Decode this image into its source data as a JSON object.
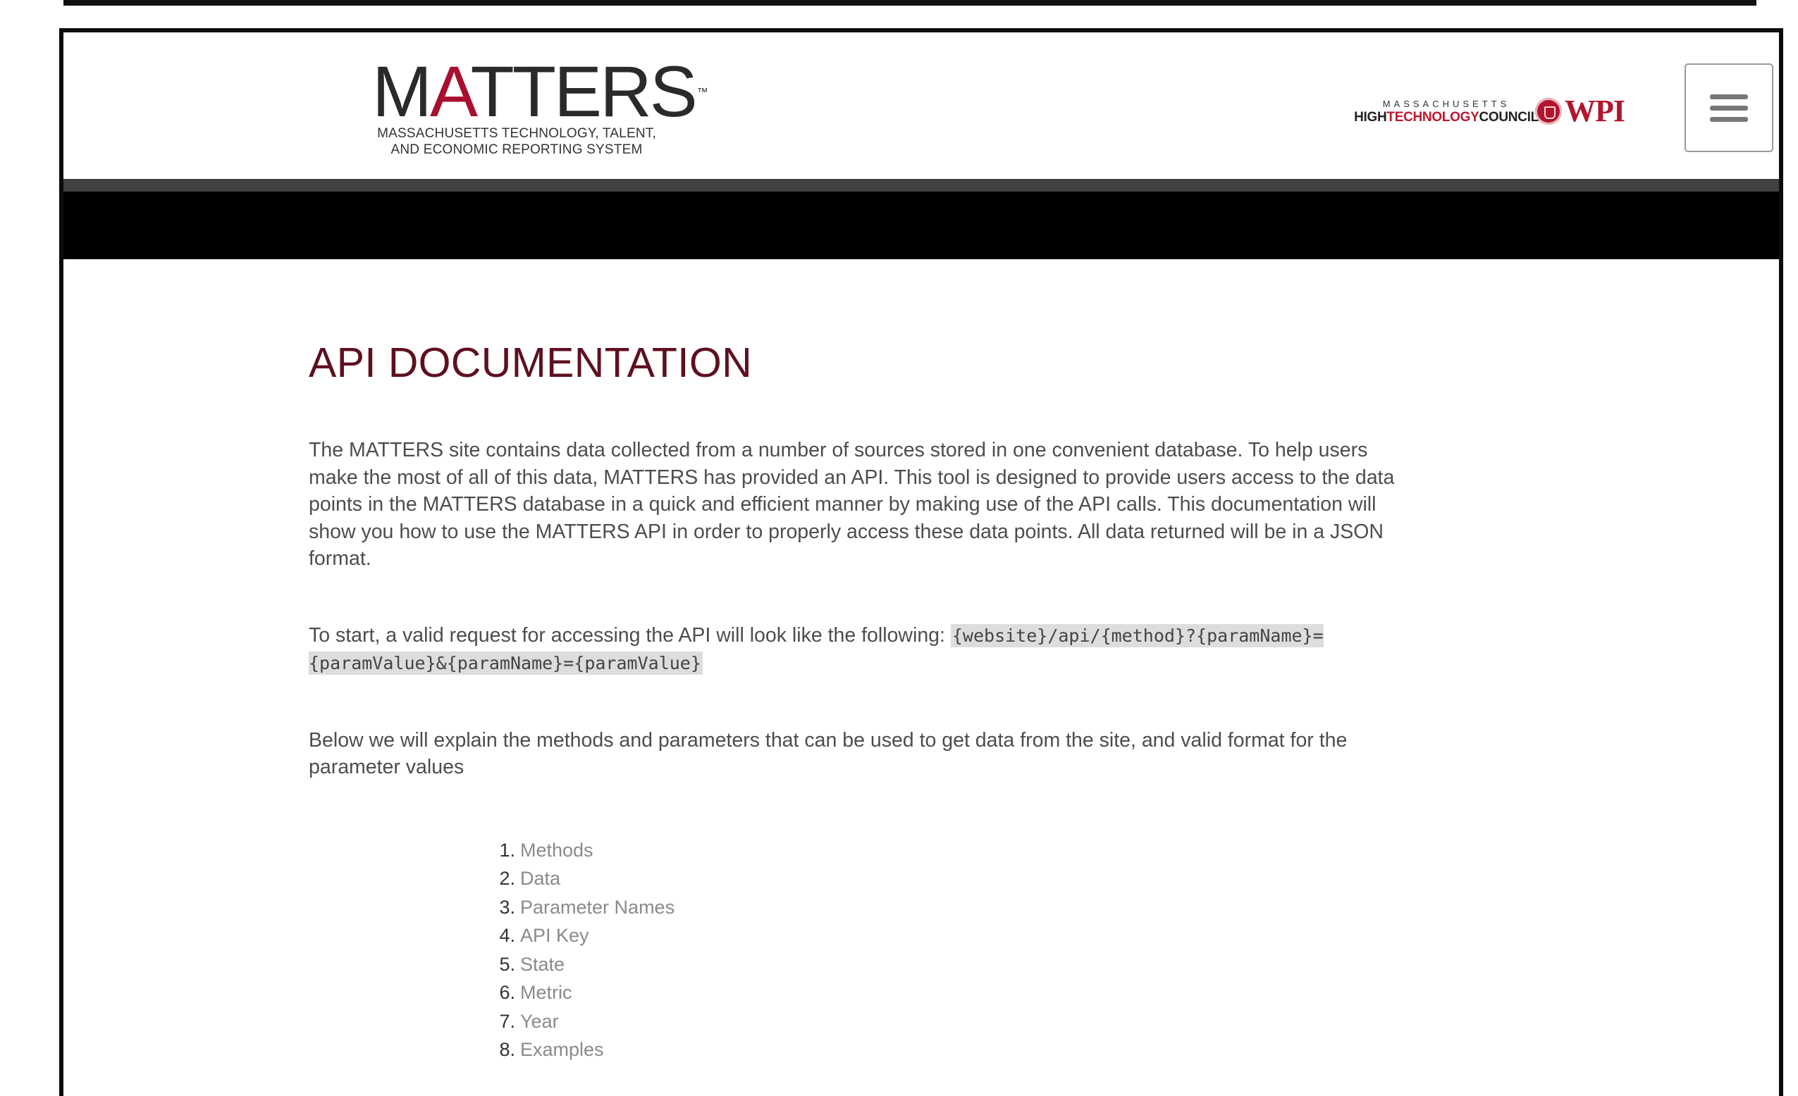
{
  "header": {
    "logo": {
      "word_dark_1": "M",
      "word_red": "A",
      "word_dark_2": "TTERS",
      "trademark": "™",
      "subtitle_line1": "MASSACHUSETTS TECHNOLOGY, TALENT,",
      "subtitle_line2": "AND ECONOMIC REPORTING SYSTEM"
    },
    "partners": {
      "mhtc_top": "MASSACHUSETTS",
      "mhtc_high": "HIGH",
      "mhtc_tech": "TECHNOLOGY",
      "mhtc_council": "COUNCIL",
      "wpi": "WPI"
    },
    "menu_icon": "hamburger-icon"
  },
  "main": {
    "title": "API DOCUMENTATION",
    "intro": "The MATTERS site contains data collected from a number of sources stored in one convenient database. To help users make the most of all of this data, MATTERS has provided an API. This tool is designed to provide users access to the data points in the MATTERS database in a quick and efficient manner by making use of the API calls. This documentation will show you how to use the MATTERS API in order to properly access these data points. All data returned will be in a JSON format.",
    "request_text": "To start, a valid request for accessing the API will look like the following: ",
    "request_code": "{website}/api/{method}?{paramName}={paramValue}&{paramName}={paramValue}",
    "explain": "Below we will explain the methods and parameters that can be used to get data from the site, and valid format for the parameter values",
    "toc": [
      {
        "num": "1.",
        "label": "Methods"
      },
      {
        "num": "2.",
        "label": "Data"
      },
      {
        "num": "3.",
        "label": "Parameter Names"
      },
      {
        "num": "4.",
        "label": "API Key"
      },
      {
        "num": "5.",
        "label": "State"
      },
      {
        "num": "6.",
        "label": "Metric"
      },
      {
        "num": "7.",
        "label": "Year"
      },
      {
        "num": "8.",
        "label": "Examples"
      }
    ]
  },
  "colors": {
    "brand_red": "#a8102e",
    "title_maroon": "#5e1020",
    "link_gray": "#8a8a8a"
  }
}
